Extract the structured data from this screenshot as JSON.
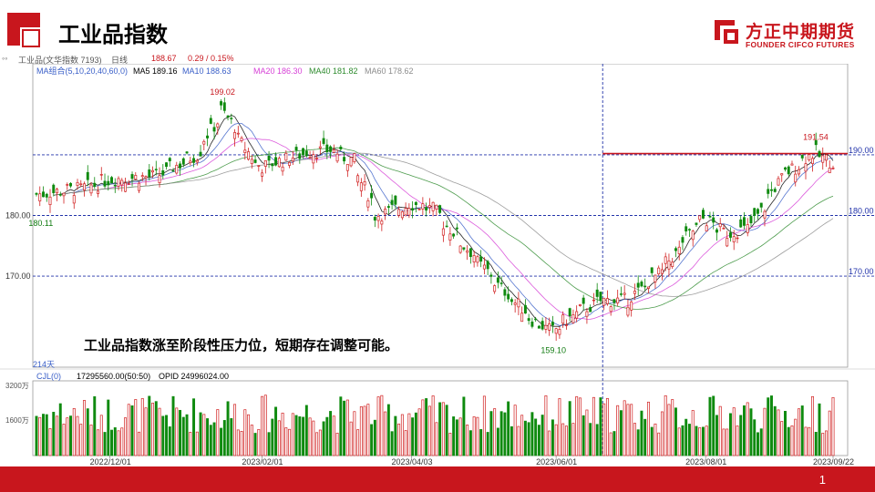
{
  "header": {
    "title": "工业品指数",
    "logo_cn": "方正中期期货",
    "logo_en": "FOUNDER CIFCO FUTURES"
  },
  "info_bar": {
    "instrument": "工业品(文华指数 7193)",
    "period": "日线",
    "last": "188.67",
    "change": "0.29 / 0.15%"
  },
  "ma_legend": {
    "group": "MA组合(5,10,20,40,60,0)",
    "items": [
      {
        "label": "MA5 189.16",
        "color": "#000000"
      },
      {
        "label": "MA10 188.63",
        "color": "#3a5fc8"
      },
      {
        "label": "MA20 186.30",
        "color": "#d63fd6"
      },
      {
        "label": "MA40 181.82",
        "color": "#2e8b2e"
      },
      {
        "label": "MA60 178.62",
        "color": "#8c8c8c"
      }
    ]
  },
  "annotation": "工业品指数涨至阶段性压力位，短期存在调整可能。",
  "volume_panel": {
    "legend": "CJL(0)",
    "volume": "17295560.00(50:50)",
    "opid": "OPID 24996024.00",
    "y_ticks": [
      "3200万",
      "1600万"
    ]
  },
  "page_number": "1",
  "chart_data": {
    "type": "candlestick",
    "title": "",
    "bars_label": "214天",
    "y_range": [
      155,
      205
    ],
    "y_ticks_left": [
      "180.00",
      "170.00"
    ],
    "hlines": [
      {
        "value": 190.0,
        "label": "190.00"
      },
      {
        "value": 180.0,
        "label": "180.00"
      },
      {
        "value": 170.0,
        "label": "170.00"
      }
    ],
    "resistance": 190.2,
    "price_labels": [
      {
        "text": "199.02",
        "value": 199.02,
        "date": "2023/01/16"
      },
      {
        "text": "180.11",
        "value": 180.11,
        "date": "2022/11/03"
      },
      {
        "text": "159.10",
        "value": 159.1,
        "date": "2023/05/31"
      },
      {
        "text": "191.54",
        "value": 191.54,
        "date": "2023/09/15"
      }
    ],
    "x_ticks": [
      "2022/12/01",
      "2023/02/01",
      "2023/04/03",
      "2023/06/01",
      "2023/08/01",
      "2023/09/22"
    ],
    "close_anchors": [
      [
        "2022/11/01",
        183.5
      ],
      [
        "2022/11/20",
        184.5
      ],
      [
        "2022/12/01",
        186.0
      ],
      [
        "2022/12/20",
        186.5
      ],
      [
        "2023/01/05",
        190.0
      ],
      [
        "2023/01/16",
        197.5
      ],
      [
        "2023/01/28",
        189.0
      ],
      [
        "2023/02/01",
        188.0
      ],
      [
        "2023/02/20",
        190.5
      ],
      [
        "2023/03/01",
        190.8
      ],
      [
        "2023/03/10",
        189.0
      ],
      [
        "2023/03/20",
        180.0
      ],
      [
        "2023/04/03",
        182.0
      ],
      [
        "2023/04/12",
        181.0
      ],
      [
        "2023/04/25",
        175.0
      ],
      [
        "2023/05/10",
        168.0
      ],
      [
        "2023/05/25",
        162.0
      ],
      [
        "2023/05/31",
        161.0
      ],
      [
        "2023/06/10",
        164.0
      ],
      [
        "2023/06/20",
        166.0
      ],
      [
        "2023/07/01",
        166.0
      ],
      [
        "2023/07/15",
        171.0
      ],
      [
        "2023/07/28",
        178.0
      ],
      [
        "2023/08/01",
        179.5
      ],
      [
        "2023/08/10",
        177.0
      ],
      [
        "2023/08/20",
        178.0
      ],
      [
        "2023/09/01",
        186.0
      ],
      [
        "2023/09/15",
        190.5
      ],
      [
        "2023/09/22",
        188.67
      ]
    ]
  }
}
